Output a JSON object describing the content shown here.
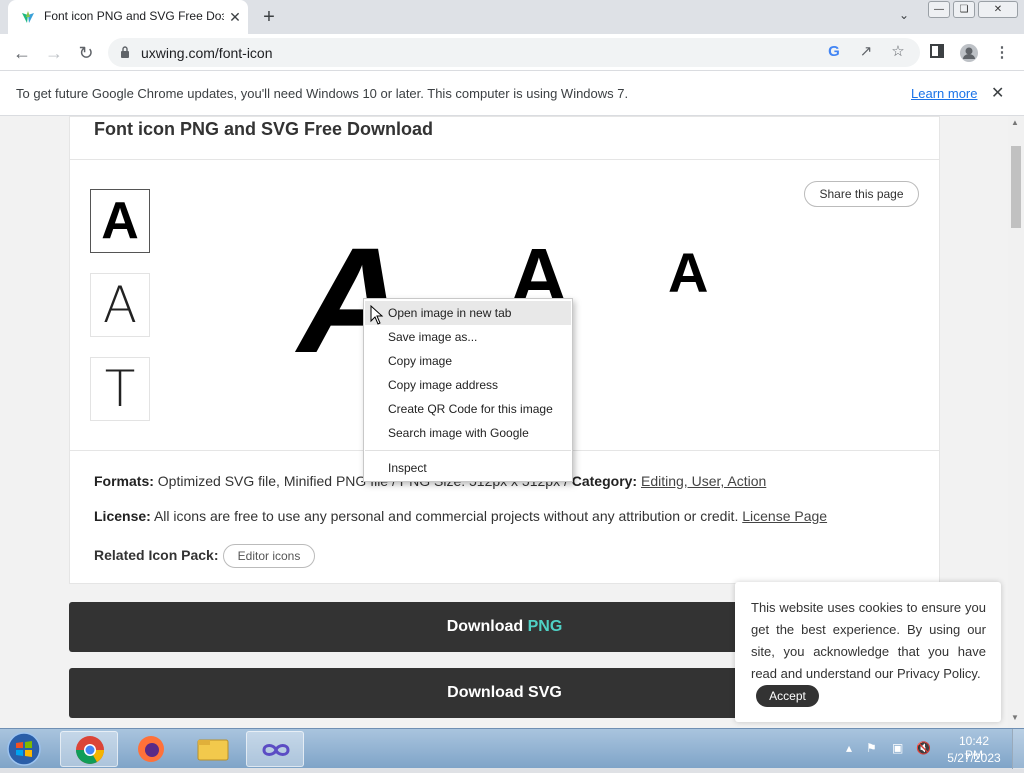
{
  "browser": {
    "tab": {
      "title": "Font icon PNG and SVG Free Doз",
      "close": "✕"
    },
    "new_tab": "+",
    "tab_search": "⌄",
    "window": {
      "minimize": "—",
      "restore": "❏",
      "close": "✕"
    },
    "nav": {
      "back": "←",
      "forward": "→",
      "reload": "↻"
    },
    "url": "uxwing.com/font-icon",
    "toolbar_icons": [
      "google-icon",
      "share-icon",
      "star-icon",
      "sidepanel-icon",
      "profile-icon",
      "menu-icon"
    ],
    "infobar": {
      "text": "To get future Google Chrome updates, you'll need Windows 10 or later. This computer is using Windows 7.",
      "learn_more": "Learn more",
      "close": "✕"
    }
  },
  "page": {
    "title": "Font icon PNG and SVG Free Download",
    "share": "Share this page",
    "thumbs": [
      "A",
      "A",
      "T"
    ],
    "preview_glyph": "A",
    "formats_label": "Formats:",
    "formats_value": "Optimized SVG file, Minified PNG file / PNG Size: 512px x 512px /",
    "category_label": "Category:",
    "category_value": "Editing, User, Action",
    "license_label": "License:",
    "license_value": "All icons are free to use any personal and commercial projects without any attribution or credit.",
    "license_link": "License Page",
    "related_label": "Related Icon Pack:",
    "related_button": "Editor icons",
    "download_png_prefix": "Download",
    "download_png_accent": "PNG",
    "download_svg": "Download SVG"
  },
  "context_menu": {
    "items": [
      "Open image in new tab",
      "Save image as...",
      "Copy image",
      "Copy image address",
      "Create QR Code for this image",
      "Search image with Google"
    ],
    "inspect": "Inspect"
  },
  "cookie": {
    "text": "This website uses cookies to ensure you get the best experience. By using our site, you acknowledge that you have read and understand our Privacy Policy.",
    "accept": "Accept"
  },
  "taskbar": {
    "time": "10:42 PM",
    "date": "5/27/2023"
  },
  "colors": {
    "accent": "#4fd1c5",
    "dark_button": "#333333"
  }
}
